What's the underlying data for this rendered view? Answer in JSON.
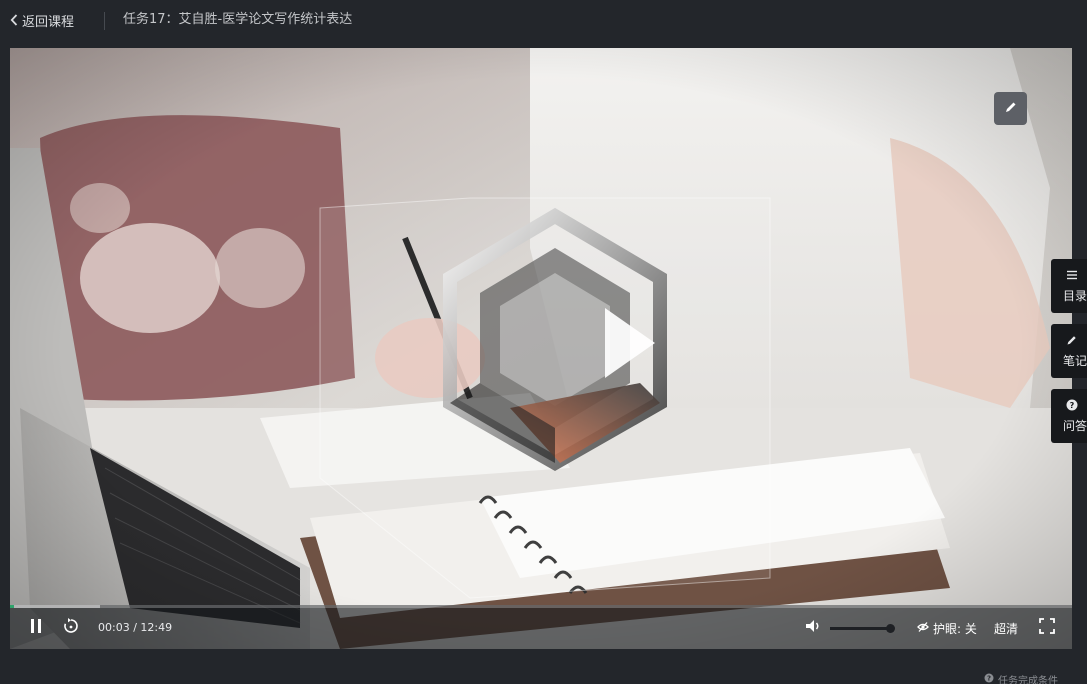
{
  "header": {
    "back_label": "返回课程",
    "task_title": "任务17：艾自胜-医学论文写作统计表达"
  },
  "player": {
    "current_time": "00:03",
    "separator": " / ",
    "duration": "12:49",
    "progress_fraction": 0.0039,
    "buffered_fraction": 0.085,
    "volume_fraction": 0.96,
    "eye_protection_label": "护眼: 关",
    "quality_label": "超清",
    "icons": {
      "back": "chevron-left-icon",
      "edit": "pencil-icon",
      "play": "play-icon",
      "pause": "pause-icon",
      "replay": "replay-icon",
      "volume": "speaker-icon",
      "eye": "eye-slash-icon",
      "fullscreen": "fullscreen-icon"
    }
  },
  "sidebar": {
    "tabs": [
      {
        "id": "catalog",
        "label": "目录",
        "icon": "list-icon"
      },
      {
        "id": "notes",
        "label": "笔记",
        "icon": "pencil-icon"
      },
      {
        "id": "qa",
        "label": "问答",
        "icon": "question-circle-icon"
      }
    ]
  },
  "footer": {
    "completion_label": "任务完成条件",
    "icon": "question-circle-icon"
  },
  "colors": {
    "page_background": "#23262b",
    "progress_played": "#2fa36b",
    "side_tab_background": "#17191c"
  }
}
